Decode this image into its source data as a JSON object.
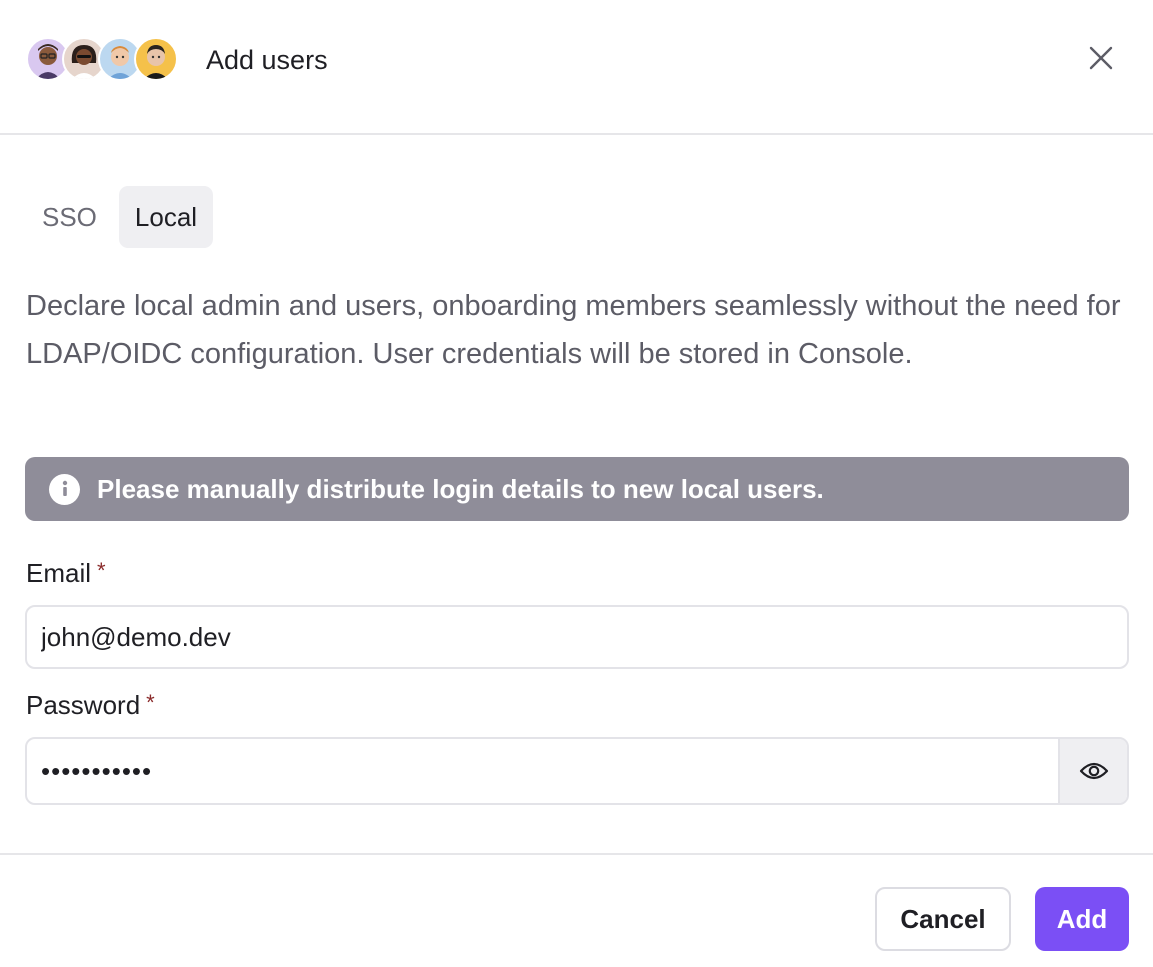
{
  "dialog": {
    "title": "Add users",
    "avatars": [
      {
        "name": "avatar-1"
      },
      {
        "name": "avatar-2"
      },
      {
        "name": "avatar-3"
      },
      {
        "name": "avatar-4"
      }
    ],
    "close_icon": "close-icon"
  },
  "tabs": [
    {
      "label": "SSO",
      "active": false
    },
    {
      "label": "Local",
      "active": true
    }
  ],
  "description": "Declare local admin and users, onboarding members seamlessly without the need for LDAP/OIDC configuration. User credentials will be stored in Console.",
  "banner": {
    "icon": "info-icon",
    "text": "Please manually distribute login details to new local users."
  },
  "form": {
    "email": {
      "label": "Email",
      "required_mark": "*",
      "value": "john@demo.dev"
    },
    "password": {
      "label": "Password",
      "required_mark": "*",
      "value": "•••••••••••",
      "toggle_icon": "eye-icon"
    }
  },
  "footer": {
    "cancel_label": "Cancel",
    "add_label": "Add"
  },
  "colors": {
    "accent": "#7b4ff5",
    "banner_bg": "#8f8d99",
    "required": "#8a2a2a"
  }
}
